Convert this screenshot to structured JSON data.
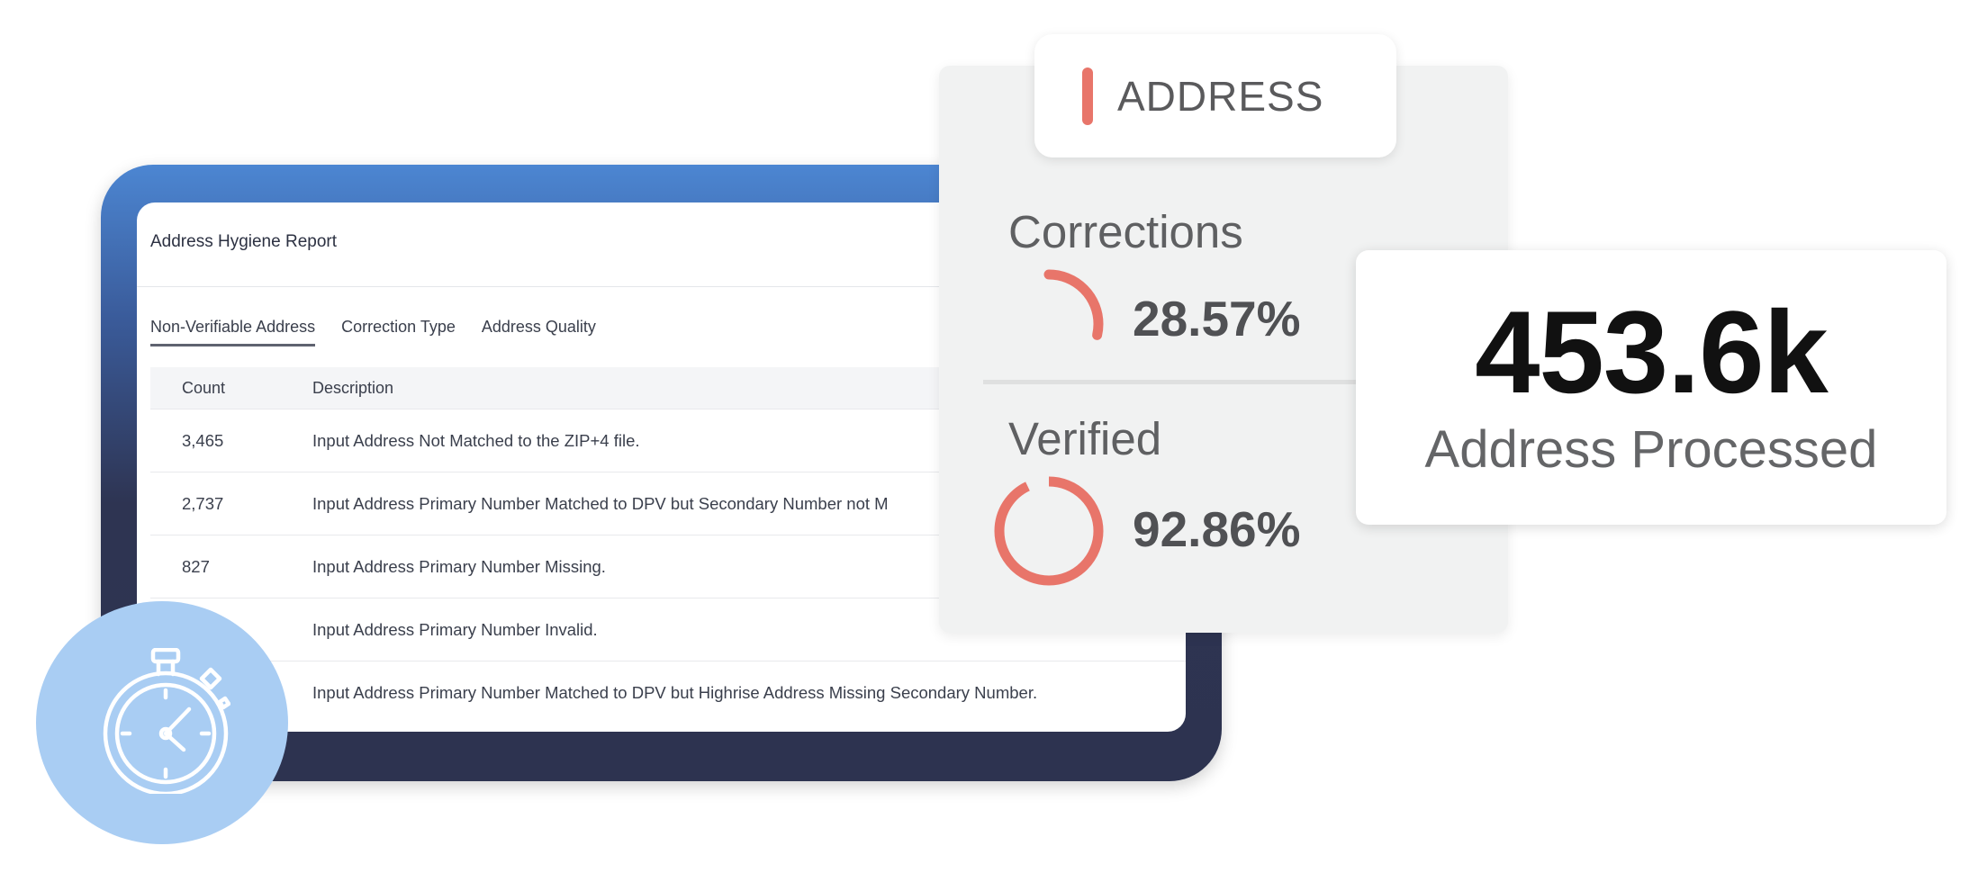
{
  "report": {
    "title": "Address Hygiene Report",
    "tabs": [
      {
        "label": "Non-Verifiable Address",
        "active": true
      },
      {
        "label": "Correction Type",
        "active": false
      },
      {
        "label": "Address Quality",
        "active": false
      }
    ],
    "columns": [
      "Count",
      "Description"
    ],
    "rows": [
      {
        "count": "3,465",
        "description": "Input Address Not Matched to the ZIP+4 file."
      },
      {
        "count": "2,737",
        "description": "Input Address Primary Number Matched to DPV but Secondary Number not M"
      },
      {
        "count": "827",
        "description": "Input Address Primary Number Missing."
      },
      {
        "count": "",
        "description": "Input Address Primary Number Invalid."
      },
      {
        "count": "",
        "description": "Input Address Primary Number Matched to DPV but Highrise Address Missing Secondary Number."
      }
    ]
  },
  "address": {
    "tag": "ADDRESS",
    "corrections": {
      "label": "Corrections",
      "value": "28.57%",
      "fraction": 0.2857
    },
    "verified": {
      "label": "Verified",
      "value": "92.86%",
      "fraction": 0.9286
    }
  },
  "processed": {
    "value": "453.6k",
    "label": "Address Processed"
  },
  "icons": {
    "timer": "stopwatch-icon"
  },
  "colors": {
    "accent": "#e8756a",
    "timer_bg": "#a9cdf3",
    "frame_top": "#4c86d2",
    "frame_bottom": "#2d3350"
  }
}
